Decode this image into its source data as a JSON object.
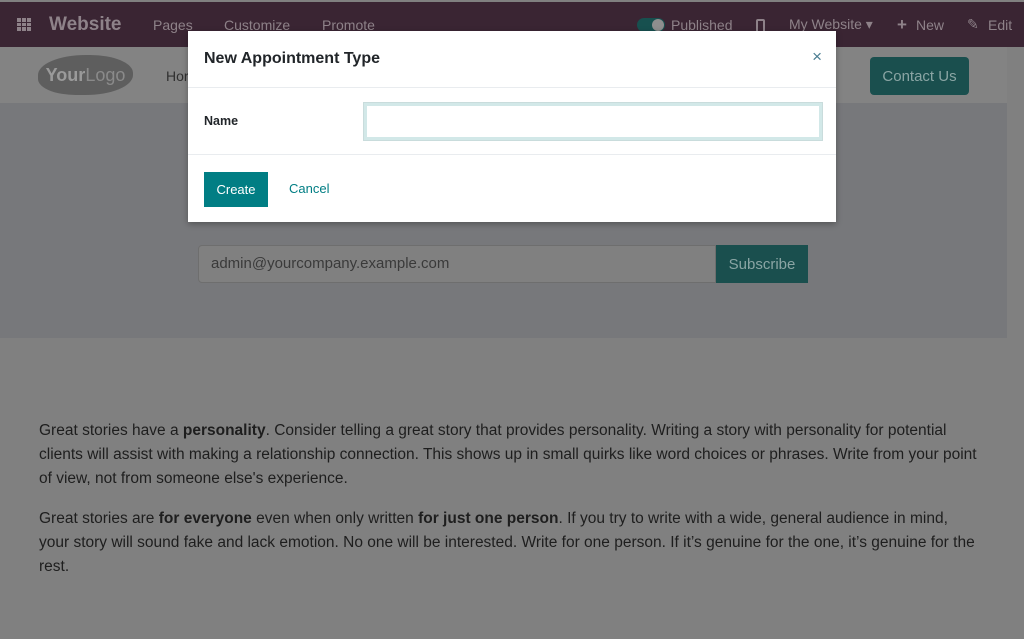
{
  "topbar": {
    "app": "Website",
    "nav": [
      "Pages",
      "Customize",
      "Promote"
    ],
    "published": "Published",
    "website": "My Website ▾",
    "new": "New",
    "edit": "Edit"
  },
  "header": {
    "logo_bold": "Your",
    "logo_light": "Logo",
    "home": "Hor",
    "contact": "Contact Us"
  },
  "newsletter": {
    "email": "admin@yourcompany.example.com",
    "subscribe": "Subscribe"
  },
  "story": {
    "p1": [
      "Great stories have a ",
      "personality",
      ". Consider telling a great story that provides personality. Writing a story with personality for potential clients will assist with making a relationship connection. This shows up in small quirks like word choices or phrases. Write from your point of view, not from someone else's experience."
    ],
    "p2": [
      "Great stories are ",
      "for everyone",
      " even when only written ",
      "for just one person",
      ". If you try to write with a wide, general audience in mind, your story will sound fake and lack emotion. No one will be interested. Write for one person. If it’s genuine for the one, it’s genuine for the rest."
    ]
  },
  "modal": {
    "title": "New Appointment Type",
    "close": "×",
    "name_label": "Name",
    "name_value": "",
    "create": "Create",
    "cancel": "Cancel"
  },
  "colors": {
    "accent": "#017e84",
    "topbar": "#3a2533"
  }
}
